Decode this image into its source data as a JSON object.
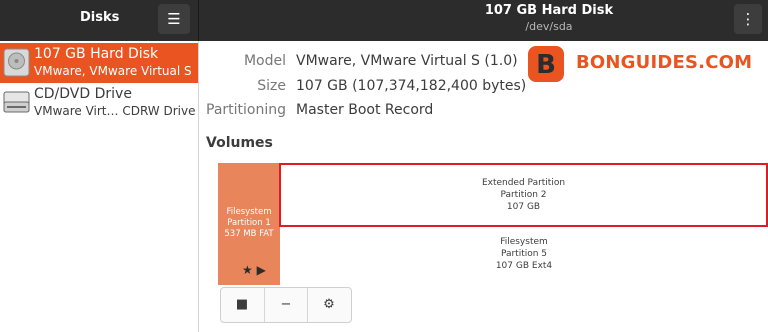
{
  "header": {
    "app_title": "Disks",
    "menu_icon": "hamburger-icon",
    "disk_title": "107 GB Hard Disk",
    "disk_subtitle": "/dev/sda",
    "kebab_icon": "kebab-menu-icon"
  },
  "sidebar": {
    "items": [
      {
        "name": "107 GB Hard Disk",
        "desc": "VMware, VMware Virtual S",
        "icon": "hard-disk-icon",
        "selected": true
      },
      {
        "name": "CD/DVD Drive",
        "desc": "VMware Virt… CDRW Drive",
        "icon": "optical-drive-icon",
        "selected": false
      }
    ]
  },
  "info": {
    "model_label": "Model",
    "model_value": "VMware, VMware Virtual S (1.0)",
    "size_label": "Size",
    "size_value": "107 GB (107,374,182,400 bytes)",
    "partitioning_label": "Partitioning",
    "partitioning_value": "Master Boot Record"
  },
  "volumes": {
    "title": "Volumes",
    "partition1": {
      "l1": "Filesystem",
      "l2": "Partition 1",
      "l3": "537 MB FAT"
    },
    "extended": {
      "l1": "Extended Partition",
      "l2": "Partition 2",
      "l3": "107 GB"
    },
    "partition5": {
      "l1": "Filesystem",
      "l2": "Partition 5",
      "l3": "107 GB Ext4"
    }
  },
  "toolbar": {
    "stop_icon": "stop-icon",
    "minus_icon": "minus-icon",
    "gear_icon": "gear-icon"
  },
  "watermark": {
    "text": "BONGUIDES.COM",
    "letter": "B"
  },
  "colors": {
    "accent": "#e95420",
    "highlight": "#e01b24",
    "partition1": "#e8855a",
    "header": "#2c2c2c"
  }
}
